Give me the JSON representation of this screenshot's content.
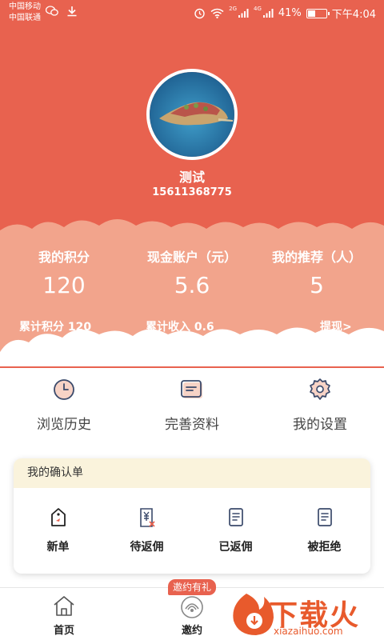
{
  "status_bar": {
    "carrier_1": "中国移动",
    "carrier_2": "中国联通",
    "signal_2g": "2G",
    "signal_4g": "4G",
    "battery": "41%",
    "battery_level": 0.41,
    "time": "下午4:04"
  },
  "profile": {
    "name": "测试",
    "phone": "15611368775"
  },
  "stats": [
    {
      "label": "我的积分",
      "value": "120"
    },
    {
      "label": "现金账户（元）",
      "value": "5.6"
    },
    {
      "label": "我的推荐（人）",
      "value": "5"
    }
  ],
  "summary": {
    "total_points": "累计积分 120",
    "total_income": "累计收入 0.6",
    "withdraw": "提现>"
  },
  "quick_links": [
    {
      "label": "浏览历史",
      "icon": "clock-icon"
    },
    {
      "label": "完善资料",
      "icon": "profile-card-icon"
    },
    {
      "label": "我的设置",
      "icon": "gear-icon"
    }
  ],
  "confirm_card": {
    "title": "我的确认单",
    "items": [
      {
        "label": "新单",
        "icon": "tag-icon"
      },
      {
        "label": "待返佣",
        "icon": "yen-cancel-icon"
      },
      {
        "label": "已返佣",
        "icon": "document-icon"
      },
      {
        "label": "被拒绝",
        "icon": "document-icon"
      }
    ]
  },
  "nav": {
    "home": "首页",
    "invite": "邀约",
    "invite_badge": "邀约有礼"
  },
  "watermark": {
    "text": "下载火",
    "url": "xiazaihuo.com"
  },
  "colors": {
    "header": "#e8624f",
    "cloud_light": "#f2a48c",
    "card_header": "#faf3dc",
    "accent": "#e8624f"
  }
}
